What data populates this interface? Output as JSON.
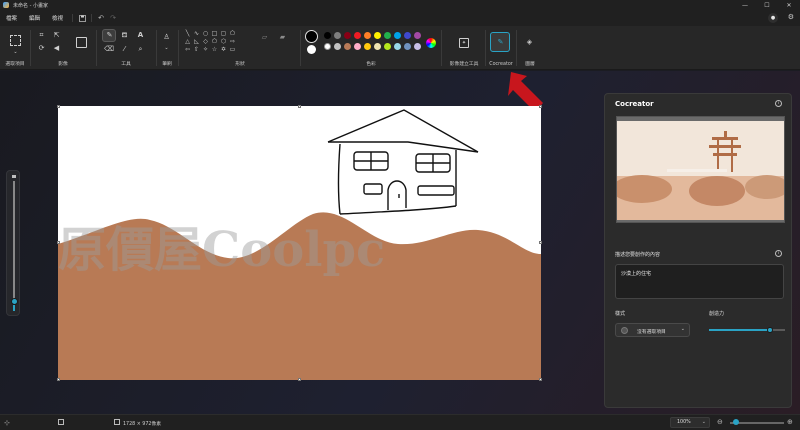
{
  "window": {
    "title": "未命名 - 小畫家",
    "minimize": "—",
    "maximize": "☐",
    "close": "✕"
  },
  "menu": {
    "items": [
      "檔案",
      "編輯",
      "檢視"
    ]
  },
  "ribbon": {
    "groups": {
      "selection": "選取項目",
      "image": "影像",
      "tools": "工具",
      "brushes": "筆刷",
      "shapes": "形狀",
      "colors": "色彩",
      "image_creator": "影像建立工具",
      "cocreator": "Cocreator",
      "layers": "圖層"
    },
    "palette": [
      "#000000",
      "#7f7f7f",
      "#880015",
      "#ed1c24",
      "#ff7f27",
      "#fff200",
      "#22b14c",
      "#00a2e8",
      "#3f48cc",
      "#a349a4",
      "#ffffff",
      "#c3c3c3",
      "#b97a57",
      "#ffaec9",
      "#ffc90e",
      "#efe4b0",
      "#b5e61d",
      "#99d9ea",
      "#7092be",
      "#c8bfe7"
    ],
    "primary_color": "#000000",
    "accent_color": "#2aa3c5"
  },
  "cocreator_panel": {
    "title": "Cocreator",
    "prompt_label": "描述您要創作的內容",
    "prompt_value": "沙漠上的住宅",
    "style_label": "樣式",
    "style_value": "沒有選取項目",
    "creativity_label": "創造力",
    "creativity_level": 0.8
  },
  "watermark": "原價屋Coolpc",
  "status": {
    "canvas_size": "1728 × 972像素",
    "zoom": "100%"
  }
}
